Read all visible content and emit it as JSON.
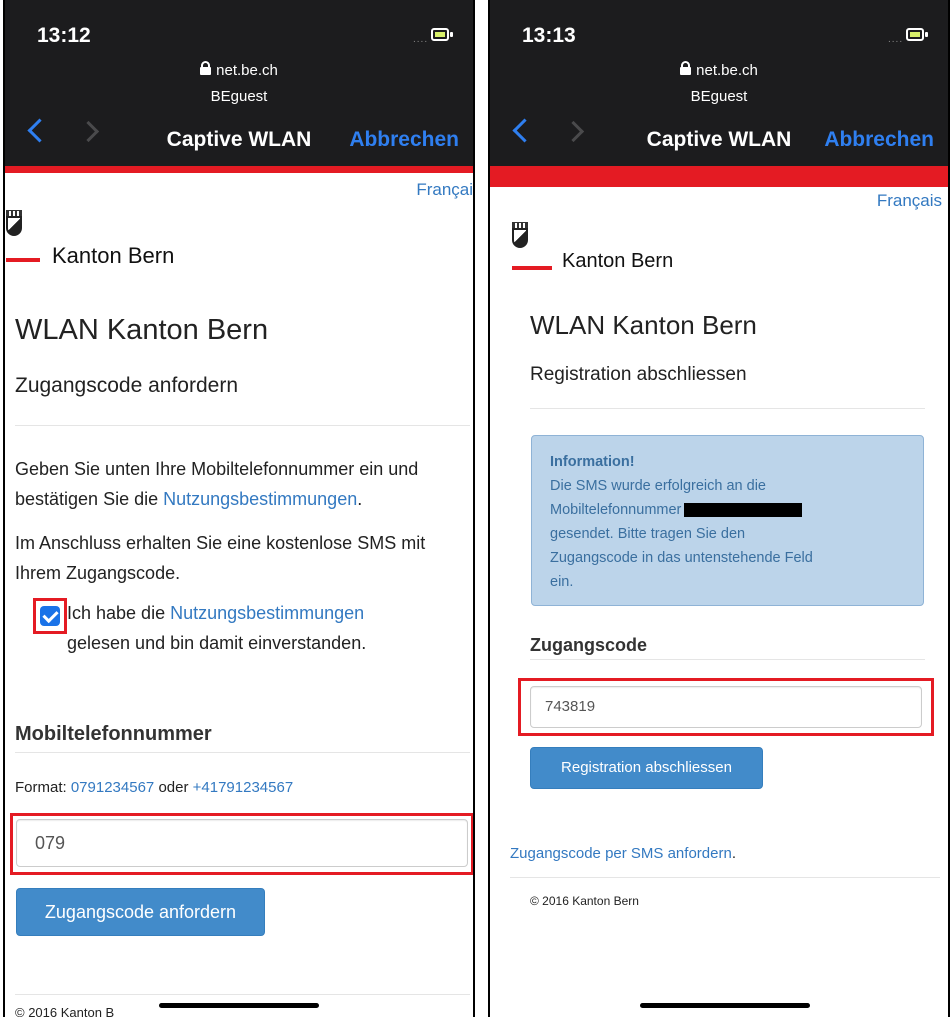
{
  "left": {
    "time": "13:12",
    "url": "net.be.ch",
    "ssid": "BEguest",
    "nav_title": "Captive WLAN",
    "cancel": "Abbrechen",
    "language": "Françai",
    "canton": "Kanton Bern",
    "page_title": "WLAN Kanton Bern",
    "section_title": "Zugangscode anfordern",
    "intro_pre": "Geben Sie unten Ihre Mobiltelefonnummer ein und bestätigen Sie die ",
    "intro_link": "Nutzungsbestimmungen",
    "intro_post": ".",
    "info_line": "Im Anschluss erhalten Sie eine kostenlose SMS mit Ihrem Zugangscode.",
    "checkbox_pre": "Ich habe die ",
    "checkbox_link": "Nutzungsbestimmungen",
    "checkbox_post": "gelesen und bin damit einverstanden.",
    "phone_label": "Mobiltelefonnummer",
    "format_label": "Format: ",
    "format_example1": "0791234567",
    "format_or": " oder ",
    "format_example2": "+41791234567",
    "phone_value": "079",
    "submit": "Zugangscode anfordern",
    "footer_partial": "© 2016 Kanton B"
  },
  "right": {
    "time": "13:13",
    "url": "net.be.ch",
    "ssid": "BEguest",
    "nav_title": "Captive WLAN",
    "cancel": "Abbrechen",
    "language": "Français",
    "canton": "Kanton Bern",
    "page_title": "WLAN Kanton Bern",
    "section_title": "Registration abschliessen",
    "alert_title": "Information!",
    "alert_line1": "Die SMS wurde erfolgreich an die",
    "alert_line2": "Mobiltelefonnummer",
    "alert_line3": "gesendet. Bitte tragen Sie den",
    "alert_line4": "Zugangscode in das untenstehende Feld",
    "alert_line5": "ein.",
    "code_label": "Zugangscode",
    "code_value": "743819",
    "submit": "Registration abschliessen",
    "resend_link": "Zugangscode per SMS anfordern",
    "resend_post": ".",
    "footer": "© 2016 Kanton Bern"
  },
  "colors": {
    "accent_red": "#e41b23",
    "link_blue": "#3379c1",
    "ios_blue": "#2f7ff0",
    "button_blue": "#428bca",
    "alert_bg": "#bcd4ea"
  }
}
